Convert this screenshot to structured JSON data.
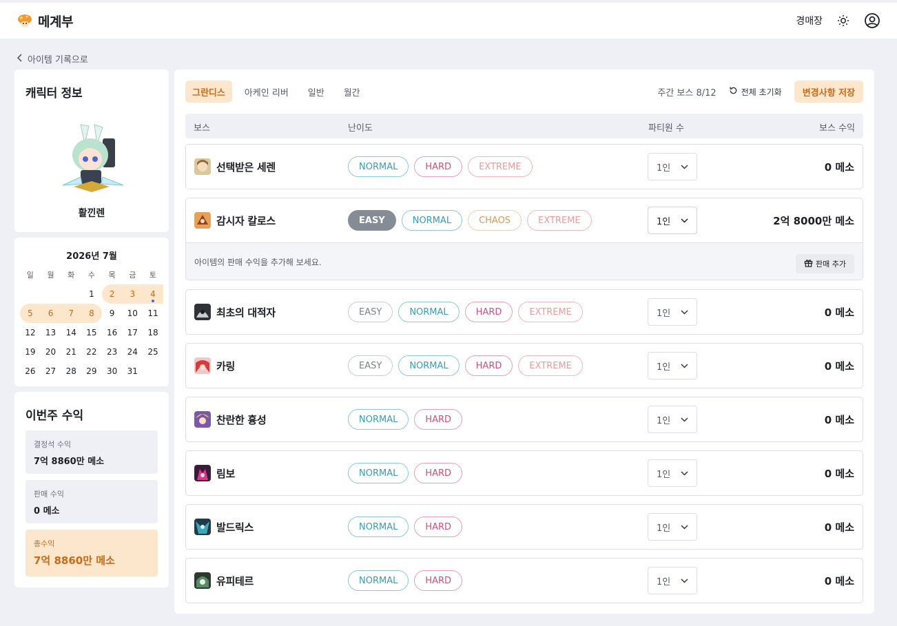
{
  "header": {
    "brand": "메계부",
    "auction_link": "경매장"
  },
  "back_link": "아이템 기록으로",
  "character": {
    "title": "캐릭터 정보",
    "name": "활낀렌"
  },
  "calendar": {
    "title": "2026년 7월",
    "weekdays": [
      "일",
      "월",
      "화",
      "수",
      "목",
      "금",
      "토"
    ],
    "weeks": [
      [
        "",
        "",
        "",
        "1",
        "2",
        "3",
        "4"
      ],
      [
        "5",
        "6",
        "7",
        "8",
        "9",
        "10",
        "11"
      ],
      [
        "12",
        "13",
        "14",
        "15",
        "16",
        "17",
        "18"
      ],
      [
        "19",
        "20",
        "21",
        "22",
        "23",
        "24",
        "25"
      ],
      [
        "26",
        "27",
        "28",
        "29",
        "30",
        "31",
        ""
      ]
    ]
  },
  "weekly_income": {
    "title": "이번주 수익",
    "crystal_label": "결정석 수익",
    "crystal_value": "7억 8860만 메소",
    "sales_label": "판매 수익",
    "sales_value": "0 메소",
    "total_label": "총수익",
    "total_value": "7억 8860만 메소"
  },
  "tabs": [
    "그란디스",
    "아케인 리버",
    "일반",
    "월간"
  ],
  "toolbar": {
    "weekly_count": "주간 보스 8/12",
    "reset_label": "전체 초기화",
    "save_label": "변경사항 저장"
  },
  "table_headers": {
    "boss": "보스",
    "difficulty": "난이도",
    "party": "파티원 수",
    "income": "보스 수익"
  },
  "bosses": [
    {
      "name": "선택받은 세렌",
      "difficulties": [
        "NORMAL",
        "HARD",
        "EXTREME"
      ],
      "party": "1인",
      "income": "0 메소"
    },
    {
      "name": "감시자 칼로스",
      "difficulties": [
        "EASY",
        "NORMAL",
        "CHAOS",
        "EXTREME"
      ],
      "selected": "EASY",
      "party": "1인",
      "income": "2억 8000만 메소",
      "extra_message": "아이템의 판매 수익을 추가해 보세요.",
      "add_sale_label": "판매 추가"
    },
    {
      "name": "최초의 대적자",
      "difficulties": [
        "EASY",
        "NORMAL",
        "HARD",
        "EXTREME"
      ],
      "party": "1인",
      "income": "0 메소"
    },
    {
      "name": "카링",
      "difficulties": [
        "EASY",
        "NORMAL",
        "HARD",
        "EXTREME"
      ],
      "party": "1인",
      "income": "0 메소"
    },
    {
      "name": "찬란한 흉성",
      "difficulties": [
        "NORMAL",
        "HARD"
      ],
      "party": "1인",
      "income": "0 메소"
    },
    {
      "name": "림보",
      "difficulties": [
        "NORMAL",
        "HARD"
      ],
      "party": "1인",
      "income": "0 메소"
    },
    {
      "name": "발드릭스",
      "difficulties": [
        "NORMAL",
        "HARD"
      ],
      "party": "1인",
      "income": "0 메소"
    },
    {
      "name": "유피테르",
      "difficulties": [
        "NORMAL",
        "HARD"
      ],
      "party": "1인",
      "income": "0 메소"
    }
  ],
  "colors": {
    "accent": "#c86a1a",
    "accent_bg": "#fde7cc",
    "normal": "#3a9bb5",
    "hard": "#cf4f79",
    "extreme": "#ee9a9a",
    "chaos": "#d69856"
  }
}
